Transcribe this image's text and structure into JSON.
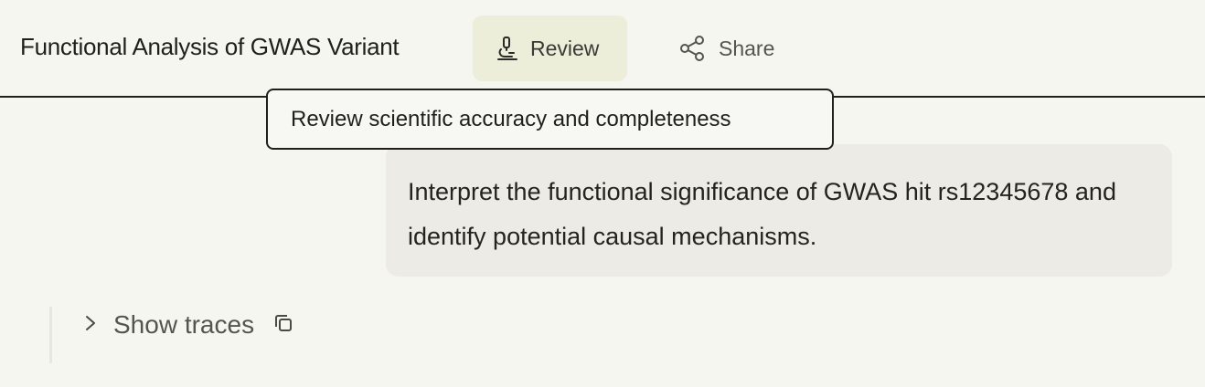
{
  "header": {
    "title": "Functional Analysis of GWAS Variant",
    "review_label": "Review",
    "share_label": "Share"
  },
  "tooltip": {
    "text": "Review scientific accuracy and completeness"
  },
  "message": {
    "text": "Interpret the functional significance of GWAS hit rs12345678 and identify potential causal mechanisms."
  },
  "traces": {
    "label": "Show traces"
  },
  "icons": {
    "review": "microscope-icon",
    "share": "share-icon",
    "traces_toggle": "chevron-right-icon",
    "copy": "copy-icon"
  },
  "colors": {
    "background": "#f6f6f1",
    "review_button_bg": "#eceed9",
    "message_bubble_bg": "#ecebe5",
    "text": "#1f1f1c"
  }
}
